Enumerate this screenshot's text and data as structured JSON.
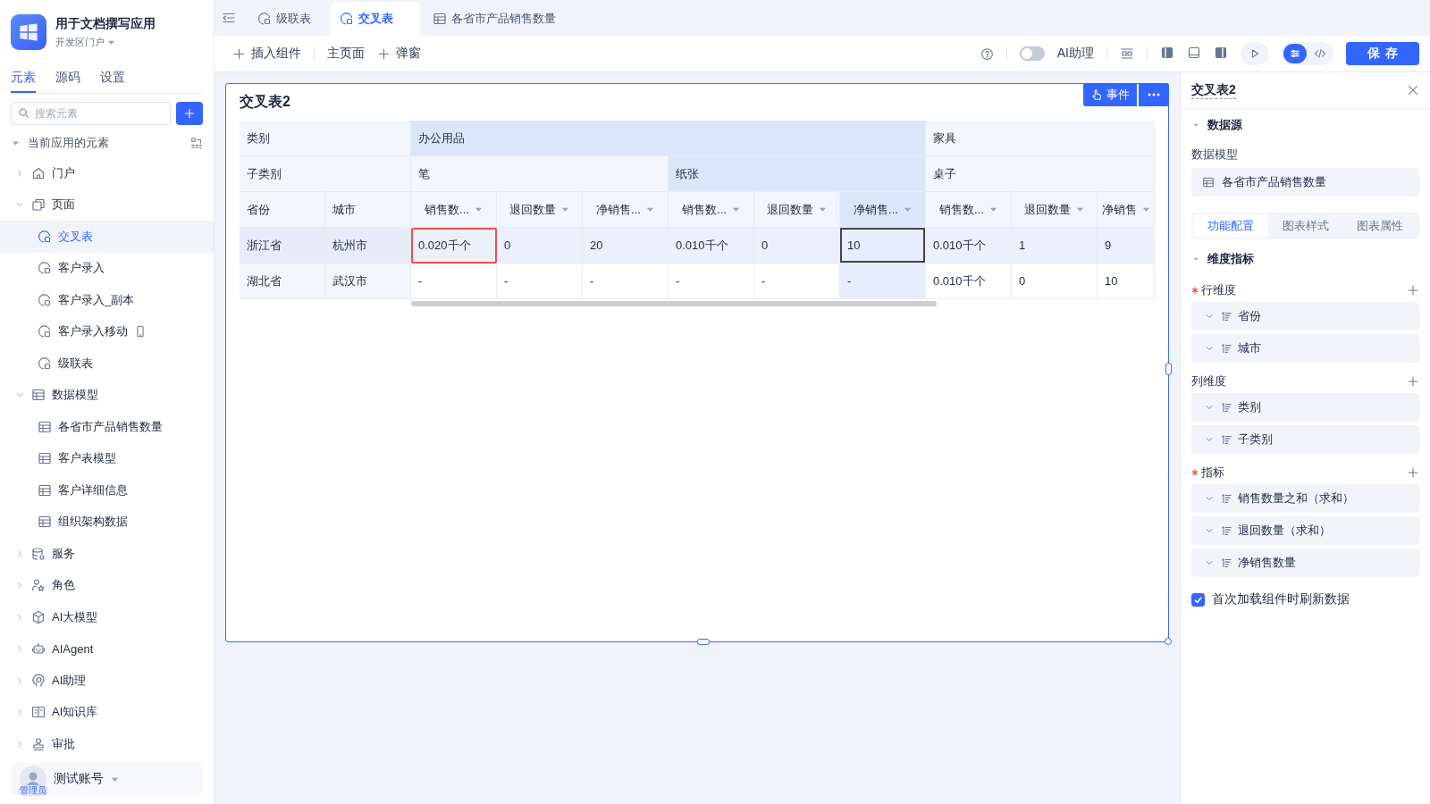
{
  "app": {
    "name": "用于文档撰写应用",
    "portal": "开发区门户"
  },
  "sidebar": {
    "tabs": [
      {
        "label": "元素",
        "selected": true
      },
      {
        "label": "源码",
        "selected": false
      },
      {
        "label": "设置",
        "selected": false
      }
    ],
    "search": {
      "placeholder": "搜索元素"
    },
    "tree": {
      "title": "当前应用的元素",
      "expanded": true,
      "children": [
        {
          "label": "门户",
          "expanded": false
        },
        {
          "label": "页面",
          "expanded": true,
          "children": [
            {
              "label": "交叉表",
              "kind": "page",
              "selected": true
            },
            {
              "label": "客户录入",
              "kind": "page",
              "selected": false
            },
            {
              "label": "客户录入_副本",
              "kind": "page",
              "selected": false
            },
            {
              "label": "客户录入移动",
              "kind": "mobile_page",
              "selected": false
            },
            {
              "label": "级联表",
              "kind": "page",
              "selected": false
            }
          ]
        },
        {
          "label": "数据模型",
          "expanded": true,
          "children": [
            {
              "label": "各省市产品销售数量",
              "kind": "table",
              "selected": false
            },
            {
              "label": "客户表模型",
              "kind": "table",
              "selected": false
            },
            {
              "label": "客户详细信息",
              "kind": "table",
              "selected": false
            },
            {
              "label": "组织架构数据",
              "kind": "table",
              "selected": false
            }
          ]
        },
        {
          "label": "服务",
          "expanded": false
        },
        {
          "label": "角色",
          "expanded": false
        },
        {
          "label": "AI大模型",
          "expanded": false
        },
        {
          "label": "AIAgent",
          "expanded": false
        },
        {
          "label": "AI助理",
          "expanded": false
        },
        {
          "label": "AI知识库",
          "expanded": false
        },
        {
          "label": "审批",
          "expanded": false
        }
      ]
    },
    "user": {
      "name": "测试账号",
      "role": "管理员"
    }
  },
  "tabs": [
    {
      "label": "级联表",
      "kind": "page",
      "selected": false
    },
    {
      "label": "交叉表",
      "kind": "page",
      "selected": true
    },
    {
      "label": "各省市产品销售数量",
      "kind": "table",
      "selected": false
    }
  ],
  "toolbar": {
    "insert": "插入组件",
    "home": "主页面",
    "popup": "弹窗",
    "assistant": {
      "label": "AI助理",
      "on": false
    },
    "view_modes": [
      {
        "kind": "settings",
        "selected": true
      },
      {
        "kind": "code",
        "selected": false
      }
    ],
    "save": "保存"
  },
  "canvas": {
    "table": {
      "title": "交叉表2",
      "event_button": "事件",
      "header_labels": [
        "类别",
        "子类别"
      ],
      "column_groups": [
        {
          "label": "办公用品",
          "highlighted": true,
          "children": [
            {
              "label": "笔",
              "highlighted": false,
              "measures": [
                {
                  "label": "销售数...",
                  "highlighted": false
                },
                {
                  "label": "退回数量",
                  "highlighted": false
                },
                {
                  "label": "净销售...",
                  "highlighted": false
                }
              ]
            },
            {
              "label": "纸张",
              "highlighted": true,
              "measures": [
                {
                  "label": "销售数...",
                  "highlighted": false
                },
                {
                  "label": "退回数量",
                  "highlighted": false
                },
                {
                  "label": "净销售...",
                  "highlighted": true
                }
              ]
            }
          ]
        },
        {
          "label": "家具",
          "highlighted": false,
          "children": [
            {
              "label": "桌子",
              "highlighted": false,
              "measures": [
                {
                  "label": "销售数...",
                  "highlighted": false
                },
                {
                  "label": "退回数量",
                  "highlighted": false
                },
                {
                  "label": "净销售",
                  "highlighted": false
                }
              ]
            }
          ]
        }
      ],
      "row_headers": [
        "省份",
        "城市"
      ],
      "rows": [
        {
          "province": "浙江省",
          "city": "杭州市",
          "highlighted": true,
          "cells": [
            {
              "text": "0.020千个",
              "selected": false,
              "invalid": true
            },
            {
              "text": "0",
              "selected": false,
              "invalid": false
            },
            {
              "text": "20",
              "selected": false,
              "invalid": false
            },
            {
              "text": "0.010千个",
              "selected": false,
              "invalid": false
            },
            {
              "text": "0",
              "selected": false,
              "invalid": false
            },
            {
              "text": "10",
              "selected": true,
              "invalid": false
            },
            {
              "text": "0.010千个",
              "selected": false,
              "invalid": false
            },
            {
              "text": "1",
              "selected": false,
              "invalid": false
            },
            {
              "text": "9",
              "selected": false,
              "invalid": false
            }
          ]
        },
        {
          "province": "湖北省",
          "city": "武汉市",
          "highlighted": false,
          "cells": [
            {
              "text": "-",
              "selected": false,
              "invalid": false
            },
            {
              "text": "-",
              "selected": false,
              "invalid": false
            },
            {
              "text": "-",
              "selected": false,
              "invalid": false
            },
            {
              "text": "-",
              "selected": false,
              "invalid": false
            },
            {
              "text": "-",
              "selected": false,
              "invalid": false
            },
            {
              "text": "-",
              "selected": false,
              "invalid": false
            },
            {
              "text": "0.010千个",
              "selected": false,
              "invalid": false
            },
            {
              "text": "0",
              "selected": false,
              "invalid": false
            },
            {
              "text": "10",
              "selected": false,
              "invalid": false
            }
          ]
        }
      ]
    }
  },
  "inspector": {
    "title": "交叉表2",
    "datasource": {
      "title": "数据源",
      "expanded": true,
      "model_label": "数据模型",
      "model": "各省市产品销售数量"
    },
    "tabs": [
      {
        "label": "功能配置",
        "selected": true
      },
      {
        "label": "图表样式",
        "selected": false
      },
      {
        "label": "图表属性",
        "selected": false
      }
    ],
    "dimensions": {
      "title": "维度指标",
      "expanded": true,
      "groups": [
        {
          "label": "行维度",
          "required": true,
          "fields": [
            "省份",
            "城市"
          ]
        },
        {
          "label": "列维度",
          "required": false,
          "fields": [
            "类别",
            "子类别"
          ]
        },
        {
          "label": "指标",
          "required": true,
          "fields": [
            "销售数量之和（求和）",
            "退回数量（求和）",
            "净销售数量"
          ]
        }
      ]
    },
    "refresh": {
      "label": "首次加载组件时刷新数据",
      "checked": true
    }
  }
}
